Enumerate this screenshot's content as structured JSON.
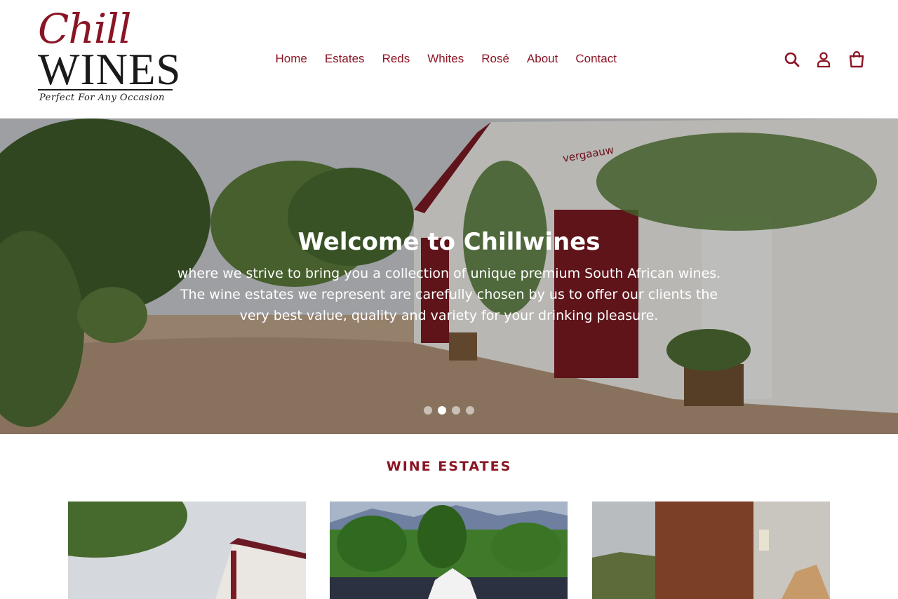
{
  "brand": {
    "script": "Chill",
    "wordmark": "WINES",
    "tagline": "Perfect For Any Occasion"
  },
  "nav": {
    "items": [
      "Home",
      "Estates",
      "Reds",
      "Whites",
      "Rosé",
      "About",
      "Contact"
    ]
  },
  "header_icons": [
    "search-icon",
    "account-icon",
    "cart-icon"
  ],
  "hero": {
    "title": "Welcome to Chillwines",
    "lines": [
      "where we strive to bring you a collection of unique premium South African wines.",
      "The wine estates we represent are carefully chosen by us to offer our clients the",
      "very best value, quality and variety for your drinking pleasure."
    ],
    "slides": 4,
    "active_slide": 2,
    "sign": "vergaauw"
  },
  "estates": {
    "heading": "WINE ESTATES",
    "cards": 3
  },
  "colors": {
    "brand": "#8a1524",
    "text_dark": "#1a1a1a",
    "background": "#ffffff"
  }
}
